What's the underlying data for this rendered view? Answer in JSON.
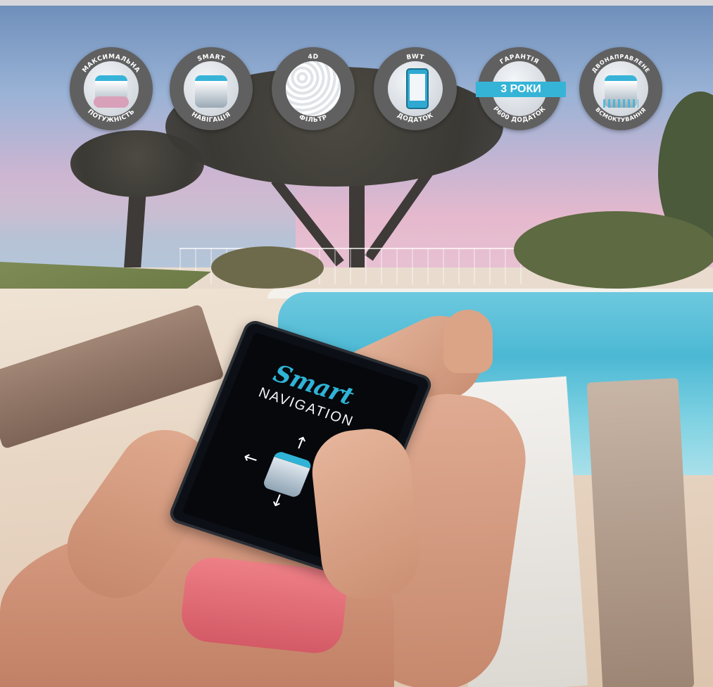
{
  "badges": [
    {
      "top": "МАКСИМАЛЬНА",
      "bottom": "ПОТУЖНІСТЬ",
      "icon": "robot-power-icon"
    },
    {
      "top": "SMART",
      "bottom": "НАВІГАЦІЯ",
      "icon": "robot-navigation-icon"
    },
    {
      "top": "4D",
      "bottom": "ФІЛЬТР",
      "icon": "filter-icon"
    },
    {
      "top": "BWT",
      "bottom": "ДОДАТОК",
      "icon": "phone-app-icon"
    },
    {
      "top": "ГАРАНТІЯ",
      "ribbon": "3 РОКИ",
      "bottom": "P600 ДОДАТОК",
      "icon": "warranty-icon"
    },
    {
      "top": "ДВОНАПРАВЛЕНЕ",
      "bottom": "ВСМОКТУВАННЯ",
      "icon": "suction-icon"
    }
  ],
  "tablet": {
    "title_script": "Smart",
    "title_main": "NAVIGATION",
    "arrows": {
      "up": "↑",
      "down": "↓",
      "left": "←",
      "right": "→"
    }
  },
  "colors": {
    "accent": "#35b4d8",
    "badge": "#606060"
  }
}
